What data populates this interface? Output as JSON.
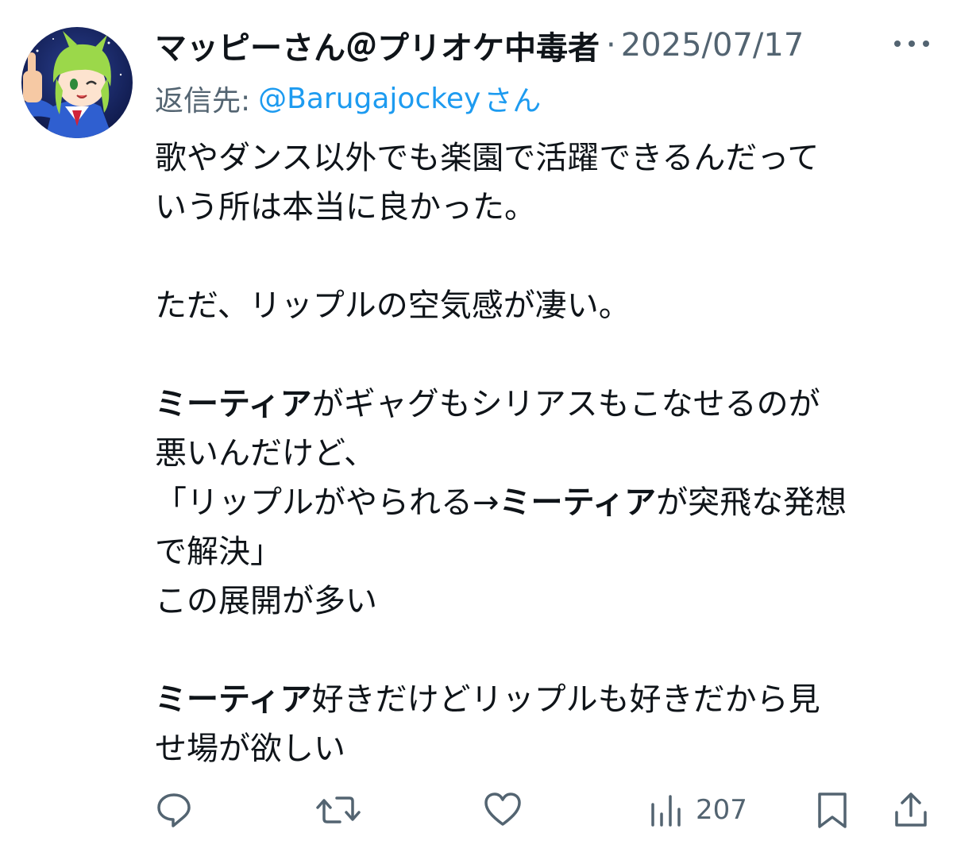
{
  "post": {
    "display_name": "マッピーさん＠プリオケ中毒者",
    "separator": "·",
    "date": "2025/07/17",
    "reply_label": "返信先:",
    "reply_handle": "@Barugajockey",
    "reply_suffix": "さん",
    "body": {
      "l1": "歌やダンス以外でも楽園で活躍できるんだって",
      "l2": "いう所は本当に良かった。",
      "l3": "ただ、リップルの空気感が凄い。",
      "l4_bold": "ミーティア",
      "l4_rest": "がギャグもシリアスもこなせるのが",
      "l5": "悪いんだけど、",
      "l6_a": "「リップルがやられる→",
      "l6_bold": "ミーティア",
      "l6_b": "が突飛な発想",
      "l7": "で解決」",
      "l8": "この展開が多い",
      "l9_bold": "ミーティア",
      "l9_rest": "好きだけどリップルも好きだから見",
      "l10": "せ場が欲しい"
    },
    "actions": {
      "reply_icon": "reply-icon",
      "repost_icon": "repost-icon",
      "like_icon": "heart-icon",
      "views_icon": "views-icon",
      "views_count": "207",
      "bookmark_icon": "bookmark-icon",
      "share_icon": "share-icon"
    }
  },
  "colors": {
    "text": "#0f1419",
    "secondary": "#536471",
    "link": "#1d9bf0"
  }
}
